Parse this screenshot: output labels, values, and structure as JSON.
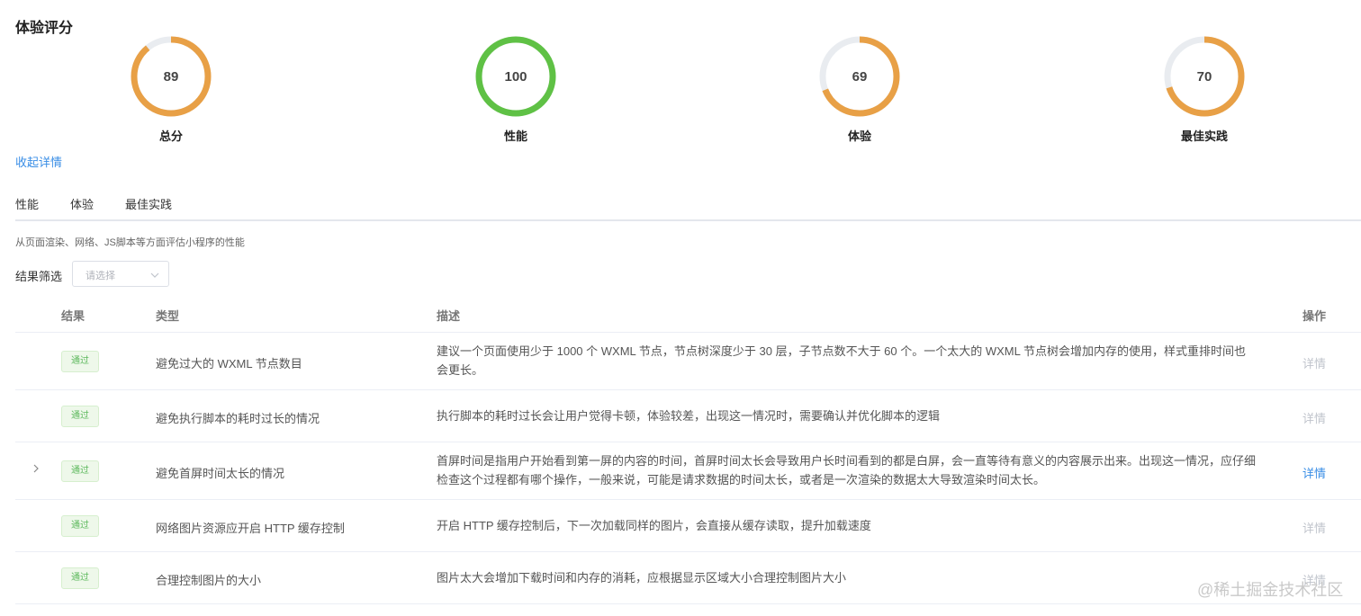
{
  "page_title": "体验评分",
  "scores": [
    {
      "label": "总分",
      "value": "89",
      "fraction": 0.89,
      "color": "#e8a046"
    },
    {
      "label": "性能",
      "value": "100",
      "fraction": 1.0,
      "color": "#5fc145"
    },
    {
      "label": "体验",
      "value": "69",
      "fraction": 0.69,
      "color": "#e8a046"
    },
    {
      "label": "最佳实践",
      "value": "70",
      "fraction": 0.7,
      "color": "#e8a046"
    }
  ],
  "track_color": "#e9ecf0",
  "collapse_link": "收起详情",
  "tabs": [
    {
      "label": "性能",
      "active": true
    },
    {
      "label": "体验",
      "active": false
    },
    {
      "label": "最佳实践",
      "active": false
    }
  ],
  "tab_description": "从页面渲染、网络、JS脚本等方面评估小程序的性能",
  "filter": {
    "label": "结果筛选",
    "placeholder": "请选择"
  },
  "table": {
    "headers": {
      "result": "结果",
      "type": "类型",
      "description": "描述",
      "action": "操作"
    },
    "rows": [
      {
        "result": "通过",
        "type": "避免过大的 WXML 节点数目",
        "description": "建议一个页面使用少于 1000 个 WXML 节点，节点树深度少于 30 层，子节点数不大于 60 个。一个太大的 WXML 节点树会增加内存的使用，样式重排时间也会更长。",
        "action": "详情",
        "action_enabled": false,
        "expandable": false
      },
      {
        "result": "通过",
        "type": "避免执行脚本的耗时过长的情况",
        "description": "执行脚本的耗时过长会让用户觉得卡顿，体验较差，出现这一情况时，需要确认并优化脚本的逻辑",
        "action": "详情",
        "action_enabled": false,
        "expandable": false
      },
      {
        "result": "通过",
        "type": "避免首屏时间太长的情况",
        "description": "首屏时间是指用户开始看到第一屏的内容的时间，首屏时间太长会导致用户长时间看到的都是白屏，会一直等待有意义的内容展示出来。出现这一情况，应仔细检查这个过程都有哪个操作，一般来说，可能是请求数据的时间太长，或者是一次渲染的数据太大导致渲染时间太长。",
        "action": "详情",
        "action_enabled": true,
        "expandable": true
      },
      {
        "result": "通过",
        "type": "网络图片资源应开启 HTTP 缓存控制",
        "description": "开启 HTTP 缓存控制后，下一次加载同样的图片，会直接从缓存读取，提升加载速度",
        "action": "详情",
        "action_enabled": false,
        "expandable": false
      },
      {
        "result": "通过",
        "type": "合理控制图片的大小",
        "description": "图片太大会增加下载时间和内存的消耗，应根据显示区域大小合理控制图片大小",
        "action": "详情",
        "action_enabled": false,
        "expandable": false
      }
    ]
  },
  "watermark": "@稀土掘金技术社区"
}
